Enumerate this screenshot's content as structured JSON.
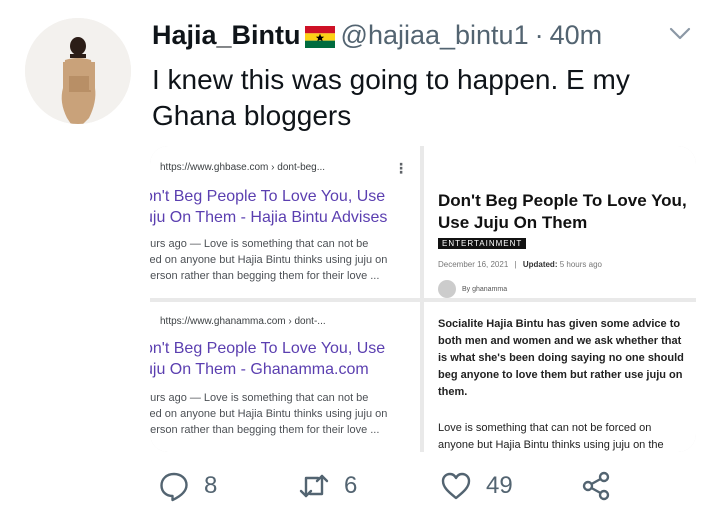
{
  "tweet": {
    "display_name": "Hajia_Bintu",
    "handle": "@hajiaa_bintu1",
    "separator": "·",
    "time": "40m",
    "text": "I knew this was going to happen. E my Ghana bloggers"
  },
  "media": {
    "result1": {
      "url": "https://www.ghbase.com › dont-beg...",
      "title_line1": "on't Beg People To Love You, Use",
      "title_line2": "uju On Them - Hajia Bintu Advises",
      "snippet_line1": "ours ago — Love is something that can not be",
      "snippet_line2": "ced on anyone but Hajia Bintu thinks using juju on",
      "snippet_line3": "person rather than begging them for their love ..."
    },
    "result2": {
      "url": "https://www.ghanamma.com › dont-...",
      "title_line1": "on't Beg People To Love You, Use",
      "title_line2": "uju On Them - Ghanamma.com",
      "snippet_line1": "ours ago — Love is something that can not be",
      "snippet_line2": "ced on anyone but Hajia Bintu thinks using juju on",
      "snippet_line3": "person rather than begging them for their love ..."
    },
    "article": {
      "title": "Don't Beg People To Love You, Use Juju On Them",
      "category": "ENTERTAINMENT",
      "date": "December 16, 2021",
      "meta_sep": "|",
      "updated_label": "Updated:",
      "updated_value": "5 hours ago",
      "byline": "By ghanamma"
    },
    "article_body": {
      "para1": "Socialite Hajia Bintu has given some advice to both men and women and we ask whether that is what she's been doing saying no one should beg anyone to love them but rather use juju on them.",
      "para2": "Love is something that can not be forced on anyone but Hajia Bintu thinks using juju on the"
    },
    "more_glyph": "⋮"
  },
  "actions": {
    "replies": "8",
    "retweets": "6",
    "likes": "49"
  },
  "colors": {
    "text": "#0f1419",
    "secondary": "#536471",
    "link_title": "#5b3fb0"
  },
  "icons": [
    "chevron-down-icon",
    "reply-icon",
    "retweet-icon",
    "like-icon",
    "share-icon",
    "ghana-flag-icon"
  ]
}
